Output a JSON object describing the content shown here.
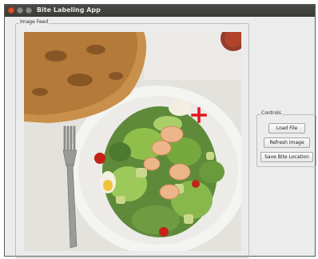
{
  "window": {
    "title": "Bite Labeling App"
  },
  "feed": {
    "label": "Image Feed"
  },
  "controls": {
    "label": "Controls",
    "load_file": "Load File",
    "refresh_image": "Refresh Image",
    "save_bite_location": "Save Bite Location"
  },
  "colors": {
    "marker": "#e8141a",
    "titlebar": "#3f3f3c",
    "close": "#e0542a"
  },
  "icons": [
    "close-icon",
    "minimize-icon",
    "maximize-icon",
    "crosshair-marker-icon"
  ]
}
